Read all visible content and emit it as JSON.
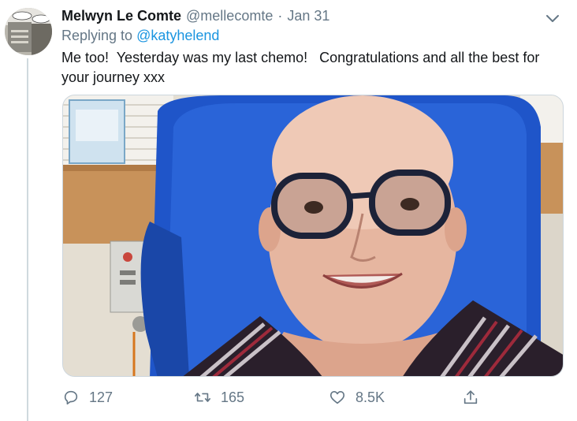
{
  "tweet": {
    "display_name": "Melwyn Le Comte",
    "handle": "@mellecomte",
    "separator": "·",
    "date": "Jan 31",
    "replying_prefix": "Replying to ",
    "replying_to": "@katyhelend",
    "text": "Me too!  Yesterday was my last chemo!   Congratulations and all the best for your journey xxx"
  },
  "actions": {
    "reply_count": "127",
    "retweet_count": "165",
    "like_count": "8.5K"
  },
  "icons": {
    "reply": "reply-icon",
    "retweet": "retweet-icon",
    "like": "heart-icon",
    "share": "share-icon",
    "menu": "chevron-down-icon"
  },
  "colors": {
    "link": "#1b95e0",
    "muted": "#657786",
    "text": "#14171a",
    "thread_line": "#cfd9de"
  }
}
